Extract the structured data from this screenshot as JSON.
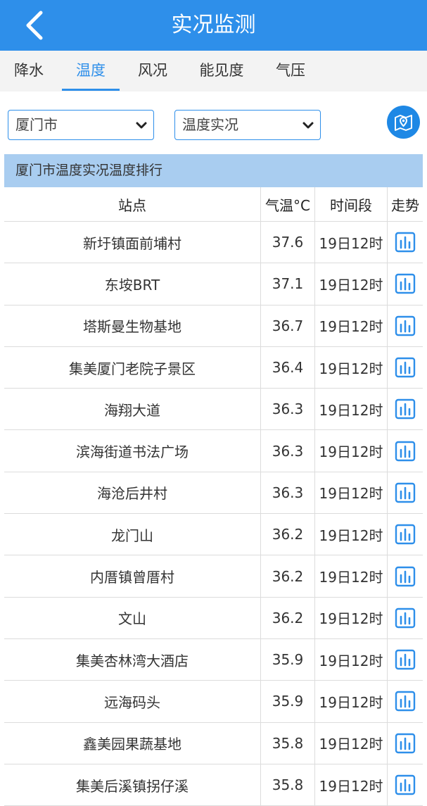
{
  "header": {
    "title": "实况监测"
  },
  "tabs": [
    {
      "label": "降水",
      "active": false
    },
    {
      "label": "温度",
      "active": true
    },
    {
      "label": "风况",
      "active": false
    },
    {
      "label": "能见度",
      "active": false
    },
    {
      "label": "气压",
      "active": false
    }
  ],
  "filters": {
    "city": "厦门市",
    "type": "温度实况"
  },
  "section": {
    "title": "厦门市温度实况温度排行"
  },
  "table": {
    "headers": {
      "station": "站点",
      "temp": "气温°C",
      "period": "时间段",
      "trend": "走势"
    },
    "rows": [
      {
        "station": "新圩镇面前埔村",
        "temp": "37.6",
        "period": "19日12时"
      },
      {
        "station": "东垵BRT",
        "temp": "37.1",
        "period": "19日12时"
      },
      {
        "station": "塔斯曼生物基地",
        "temp": "36.7",
        "period": "19日12时"
      },
      {
        "station": "集美厦门老院子景区",
        "temp": "36.4",
        "period": "19日12时"
      },
      {
        "station": "海翔大道",
        "temp": "36.3",
        "period": "19日12时"
      },
      {
        "station": "滨海街道书法广场",
        "temp": "36.3",
        "period": "19日12时"
      },
      {
        "station": "海沧后井村",
        "temp": "36.3",
        "period": "19日12时"
      },
      {
        "station": "龙门山",
        "temp": "36.2",
        "period": "19日12时"
      },
      {
        "station": "内厝镇曾厝村",
        "temp": "36.2",
        "period": "19日12时"
      },
      {
        "station": "文山",
        "temp": "36.2",
        "period": "19日12时"
      },
      {
        "station": "集美杏林湾大酒店",
        "temp": "35.9",
        "period": "19日12时"
      },
      {
        "station": "远海码头",
        "temp": "35.9",
        "period": "19日12时"
      },
      {
        "station": "鑫美园果蔬基地",
        "temp": "35.8",
        "period": "19日12时"
      },
      {
        "station": "集美后溪镇拐仔溪",
        "temp": "35.8",
        "period": "19日12时"
      }
    ]
  },
  "icons": {
    "back": "chevron-left-icon",
    "dropdown": "chevron-down-icon",
    "map": "map-icon",
    "trend": "bar-chart-icon"
  },
  "colors": {
    "brand": "#2e8fea",
    "section_bg": "#a9cdf0",
    "tab_bg": "#f3f3f3"
  }
}
